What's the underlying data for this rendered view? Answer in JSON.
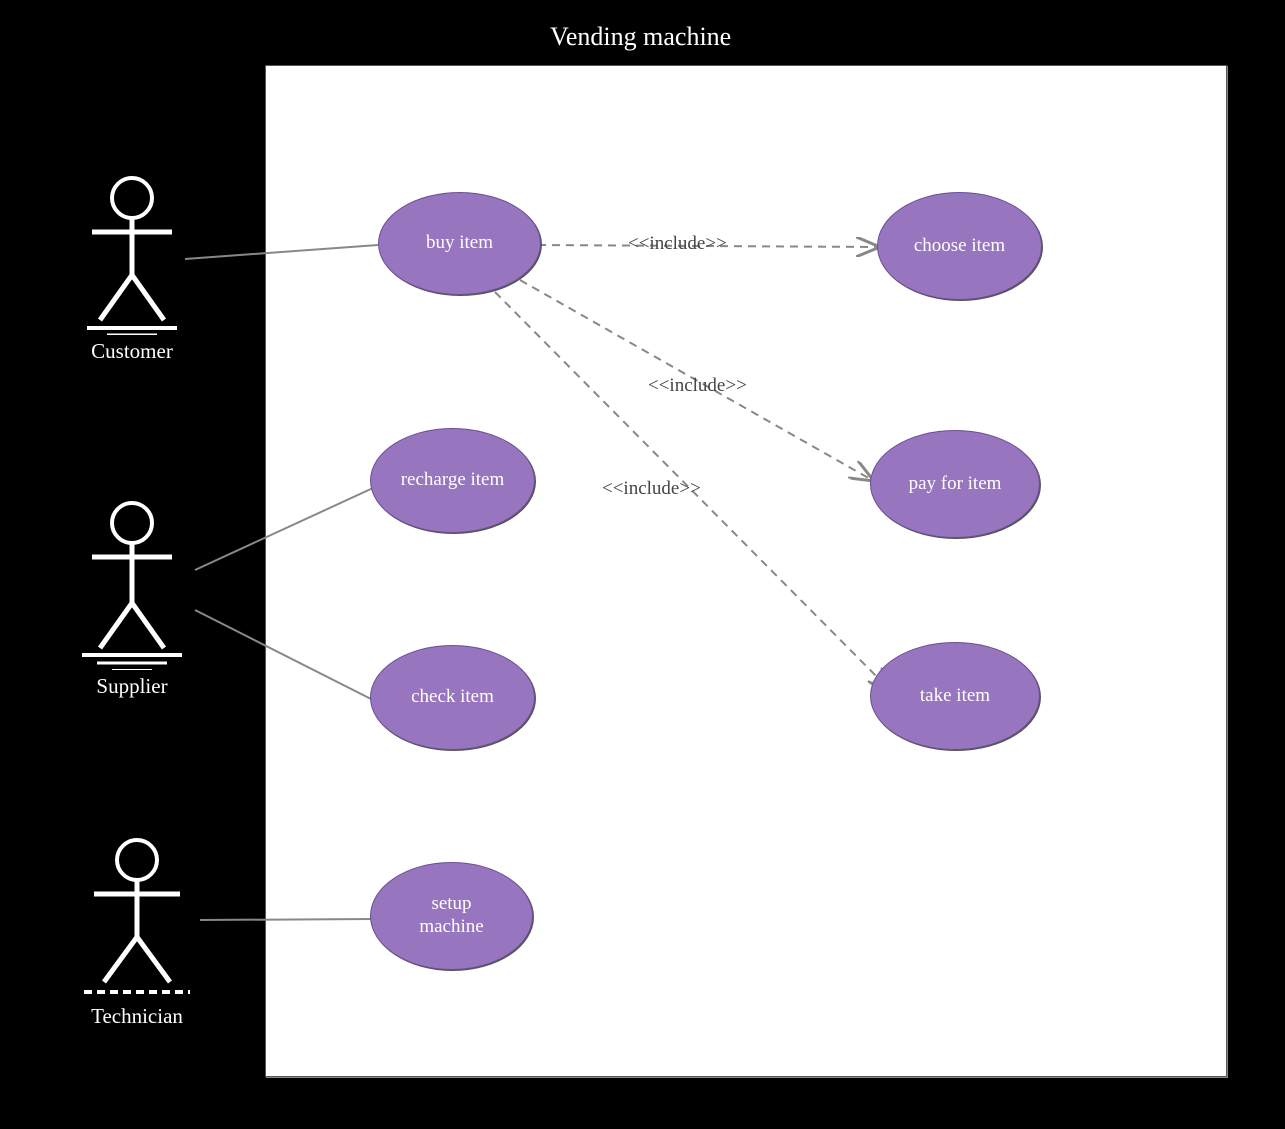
{
  "diagram_type": "UML Use Case Diagram",
  "system": {
    "name": "Vending machine"
  },
  "actors": {
    "customer": "Customer",
    "supplier": "Supplier",
    "technician": "Technician"
  },
  "use_cases": {
    "buy_item": "buy item",
    "recharge_item": "recharge item",
    "check_item": "check item",
    "setup_machine": "setup\nmachine",
    "choose_item": "choose item",
    "pay_for_item": "pay for item",
    "take_item": "take item"
  },
  "relations": {
    "include1": "<<include>>",
    "include2": "<<include>>",
    "include3": "<<include>>"
  },
  "colors": {
    "use_case_fill": "#9775bf",
    "use_case_stroke": "#6b4f93",
    "background": "#000000",
    "panel": "#ffffff"
  }
}
